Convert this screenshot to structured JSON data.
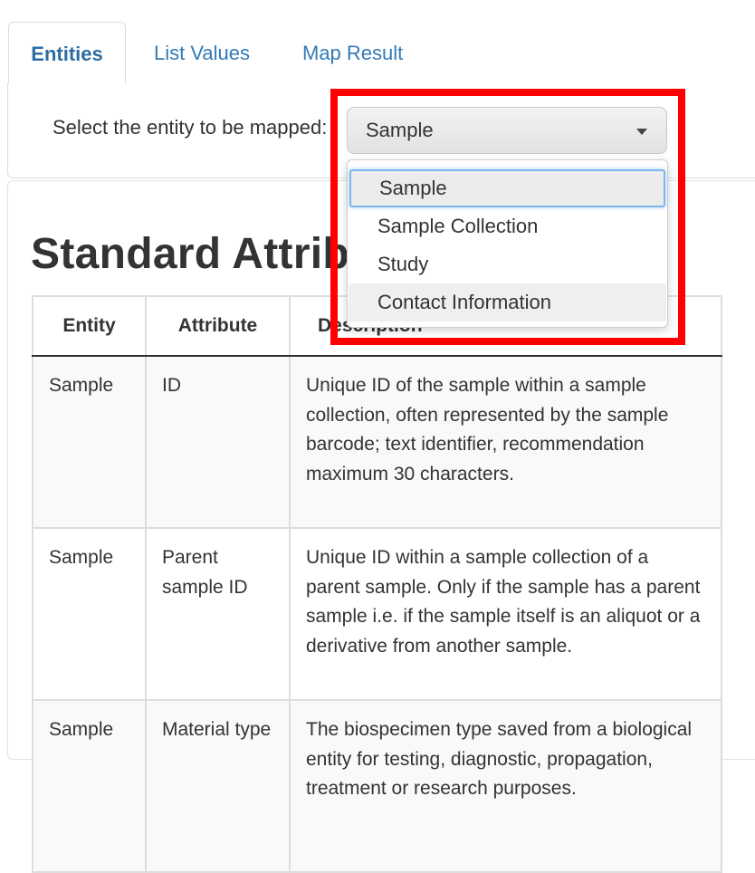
{
  "tabs": [
    {
      "label": "Entities",
      "active": true
    },
    {
      "label": "List Values",
      "active": false
    },
    {
      "label": "Map Result",
      "active": false
    }
  ],
  "entity_select": {
    "label": "Select the entity to be mapped:",
    "selected_value": "Sample",
    "options": [
      "Sample",
      "Sample Collection",
      "Study",
      "Contact Information"
    ],
    "caret_icon": "caret-down-icon"
  },
  "section": {
    "title": "Standard Attributes"
  },
  "table": {
    "headers": [
      "Entity",
      "Attribute",
      "Description"
    ],
    "rows": [
      {
        "entity": "Sample",
        "attribute": "ID",
        "description": "Unique ID of the sample within a sample collection, often represented by the sample barcode; text identifier, recommendation maximum 30 characters."
      },
      {
        "entity": "Sample",
        "attribute": "Parent sample ID",
        "description": "Unique ID within a sample collection of a parent sample. Only if the sample has a parent sample i.e. if the sample itself is an aliquot or a derivative from another sample."
      },
      {
        "entity": "Sample",
        "attribute": "Material type",
        "description": "The biospecimen type saved from a biological entity for testing, diagnostic, propagation, treatment or research purposes."
      }
    ]
  },
  "colors": {
    "link": "#337ab7",
    "highlight": "#ff0000",
    "focus_ring": "#7fb4ec"
  }
}
